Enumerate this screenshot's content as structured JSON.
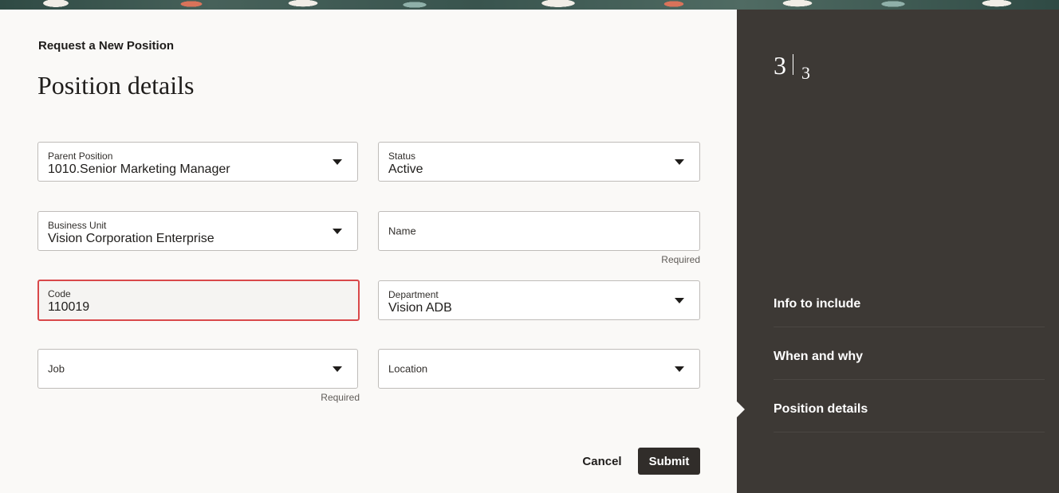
{
  "page": {
    "breadcrumb": "Request a New Position",
    "title": "Position details"
  },
  "form": {
    "parent_position": {
      "label": "Parent Position",
      "value": "1010.Senior Marketing Manager"
    },
    "status": {
      "label": "Status",
      "value": "Active"
    },
    "business_unit": {
      "label": "Business Unit",
      "value": "Vision Corporation Enterprise"
    },
    "name": {
      "label": "Name",
      "value": "",
      "required": "Required"
    },
    "code": {
      "label": "Code",
      "value": "110019"
    },
    "department": {
      "label": "Department",
      "value": "Vision ADB"
    },
    "job": {
      "label": "Job",
      "value": "",
      "required": "Required"
    },
    "location": {
      "label": "Location",
      "value": ""
    }
  },
  "actions": {
    "cancel": "Cancel",
    "submit": "Submit"
  },
  "sidebar": {
    "step_current": "3",
    "step_total": "3",
    "steps": [
      {
        "label": "Info to include"
      },
      {
        "label": "When and why"
      },
      {
        "label": "Position details"
      }
    ]
  },
  "colors": {
    "accent": "#312d2a",
    "focus_border": "#d9484a",
    "sidebar_bg": "#3d3935"
  }
}
